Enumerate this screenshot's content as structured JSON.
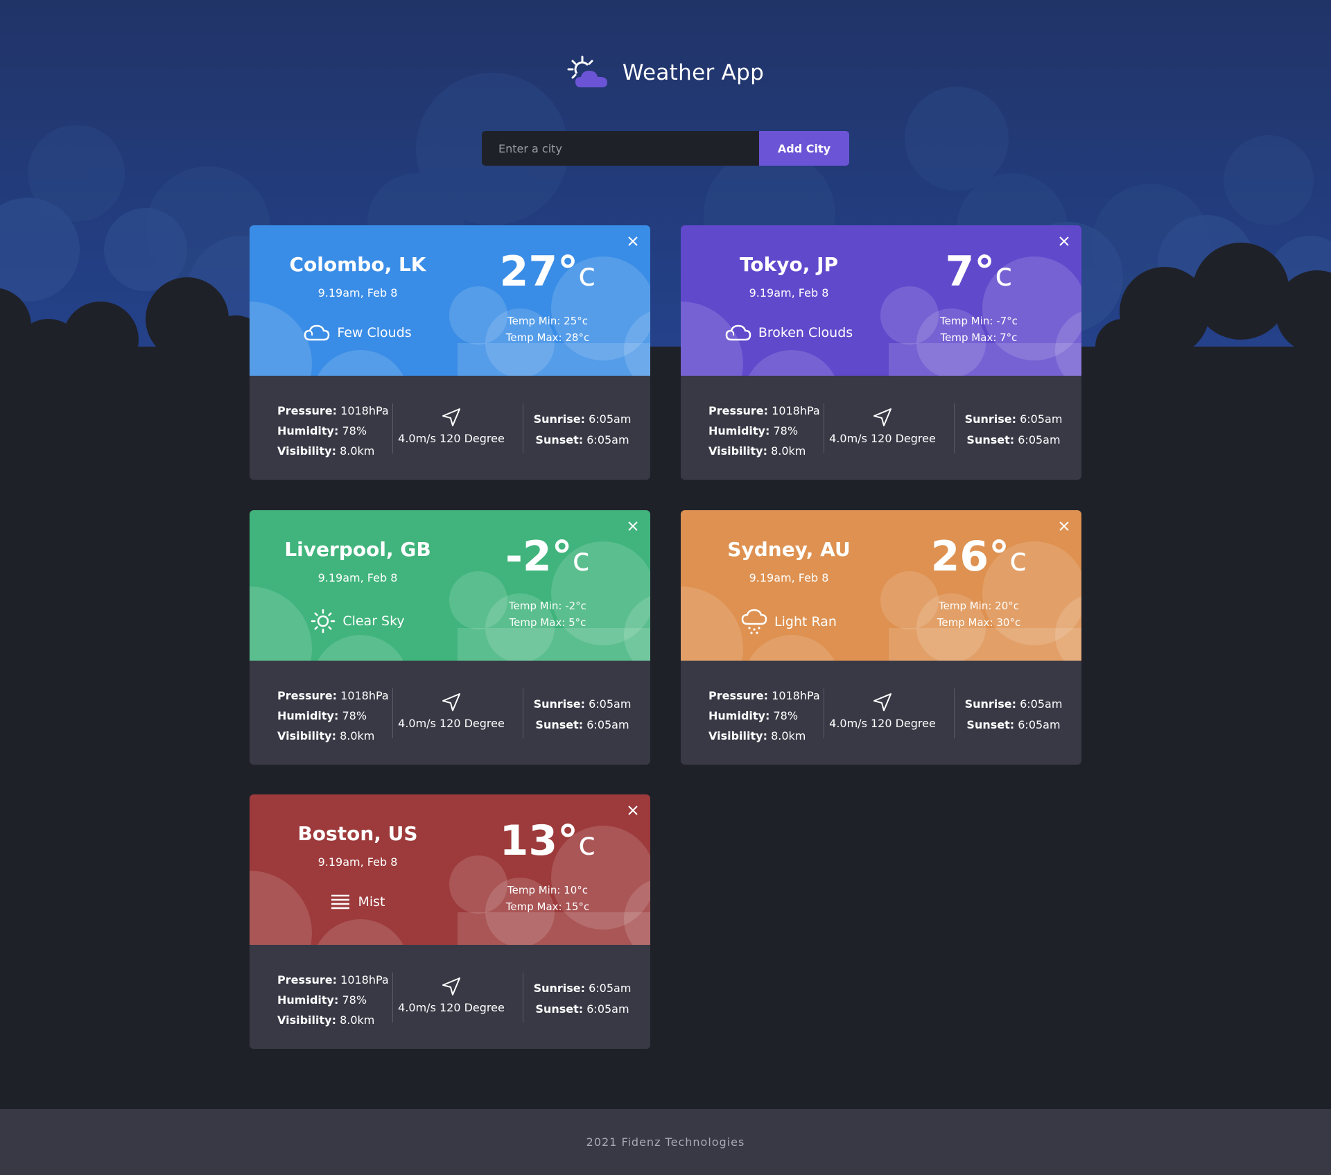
{
  "header": {
    "title": "Weather App",
    "logo_icon": "sun-cloud-icon"
  },
  "search": {
    "placeholder": "Enter a city",
    "value": "",
    "button_label": "Add City"
  },
  "colors": {
    "background": "#1f2129",
    "sky": "#233d7c",
    "accent": "#6b55d6",
    "card_bottom": "#383945"
  },
  "cards": [
    {
      "city": "Colombo, LK",
      "time": "9.19am, Feb 8",
      "condition": "Few Clouds",
      "condition_icon": "cloud-icon",
      "temp": "27°",
      "temp_unit": "c",
      "temp_min": "Temp Min: 25°c",
      "temp_max": "Temp Max: 28°c",
      "pressure_label": "Pressure:",
      "pressure": "1018hPa",
      "humidity_label": "Humidity:",
      "humidity": "78%",
      "visibility_label": "Visibility:",
      "visibility": "8.0km",
      "wind": "4.0m/s 120 Degree",
      "sunrise_label": "Sunrise:",
      "sunrise": "6:05am",
      "sunset_label": "Sunset:",
      "sunset": "6:05am",
      "color": "#3a8de6"
    },
    {
      "city": "Tokyo, JP",
      "time": "9.19am, Feb 8",
      "condition": "Broken Clouds",
      "condition_icon": "cloud-icon",
      "temp": "7°",
      "temp_unit": "c",
      "temp_min": "Temp Min: -7°c",
      "temp_max": "Temp Max: 7°c",
      "pressure_label": "Pressure:",
      "pressure": "1018hPa",
      "humidity_label": "Humidity:",
      "humidity": "78%",
      "visibility_label": "Visibility:",
      "visibility": "8.0km",
      "wind": "4.0m/s 120 Degree",
      "sunrise_label": "Sunrise:",
      "sunrise": "6:05am",
      "sunset_label": "Sunset:",
      "sunset": "6:05am",
      "color": "#6149cc"
    },
    {
      "city": "Liverpool, GB",
      "time": "9.19am, Feb 8",
      "condition": "Clear Sky",
      "condition_icon": "sun-icon",
      "temp": "-2°",
      "temp_unit": "c",
      "temp_min": "Temp Min: -2°c",
      "temp_max": "Temp Max: 5°c",
      "pressure_label": "Pressure:",
      "pressure": "1018hPa",
      "humidity_label": "Humidity:",
      "humidity": "78%",
      "visibility_label": "Visibility:",
      "visibility": "8.0km",
      "wind": "4.0m/s 120 Degree",
      "sunrise_label": "Sunrise:",
      "sunrise": "6:05am",
      "sunset_label": "Sunset:",
      "sunset": "6:05am",
      "color": "#40b47c"
    },
    {
      "city": "Sydney, AU",
      "time": "9.19am, Feb 8",
      "condition": "Light Ran",
      "condition_icon": "rain-cloud-icon",
      "temp": "26°",
      "temp_unit": "c",
      "temp_min": "Temp Min: 20°c",
      "temp_max": "Temp Max: 30°c",
      "pressure_label": "Pressure:",
      "pressure": "1018hPa",
      "humidity_label": "Humidity:",
      "humidity": "78%",
      "visibility_label": "Visibility:",
      "visibility": "8.0km",
      "wind": "4.0m/s 120 Degree",
      "sunrise_label": "Sunrise:",
      "sunrise": "6:05am",
      "sunset_label": "Sunset:",
      "sunset": "6:05am",
      "color": "#de9150"
    },
    {
      "city": "Boston, US",
      "time": "9.19am, Feb 8",
      "condition": "Mist",
      "condition_icon": "mist-icon",
      "temp": "13°",
      "temp_unit": "c",
      "temp_min": "Temp Min: 10°c",
      "temp_max": "Temp Max: 15°c",
      "pressure_label": "Pressure:",
      "pressure": "1018hPa",
      "humidity_label": "Humidity:",
      "humidity": "78%",
      "visibility_label": "Visibility:",
      "visibility": "8.0km",
      "wind": "4.0m/s 120 Degree",
      "sunrise_label": "Sunrise:",
      "sunrise": "6:05am",
      "sunset_label": "Sunset:",
      "sunset": "6:05am",
      "color": "#9d3a3b"
    }
  ],
  "footer": {
    "text": "2021 Fidenz Technologies"
  }
}
